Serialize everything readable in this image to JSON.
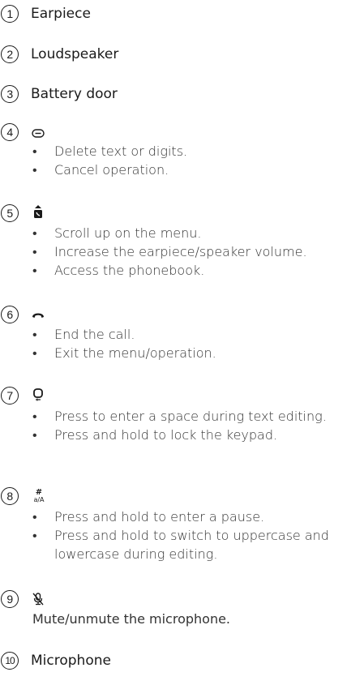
{
  "items": [
    {
      "num": "1",
      "title": "Earpiece"
    },
    {
      "num": "2",
      "title": "Loudspeaker"
    },
    {
      "num": "3",
      "title": "Battery door"
    },
    {
      "num": "4",
      "icon": "delete-key-icon",
      "bullets": [
        "Delete text or digits.",
        "Cancel operation."
      ]
    },
    {
      "num": "5",
      "icon": "scroll-up-phonebook-icon",
      "bullets": [
        "Scroll up on the menu.",
        "Increase the earpiece/speaker volume.",
        "Access the phonebook."
      ]
    },
    {
      "num": "6",
      "icon": "end-call-icon",
      "bullets": [
        "End the call.",
        "Exit the menu/operation."
      ]
    },
    {
      "num": "7",
      "icon": "zero-lock-key-icon",
      "bullets": [
        "Press to enter a space during text editing.",
        "Press and hold to lock the keypad."
      ]
    },
    {
      "num": "8",
      "icon": "hash-key-icon",
      "icon_text": [
        "#",
        "a/A"
      ],
      "bullets": [
        "Press and hold to enter a pause.",
        "Press and hold to switch to uppercase and lowercase during editing."
      ]
    },
    {
      "num": "9",
      "icon": "mute-microphone-icon",
      "text": "Mute/unmute the microphone."
    },
    {
      "num": "10",
      "title": "Microphone"
    }
  ]
}
